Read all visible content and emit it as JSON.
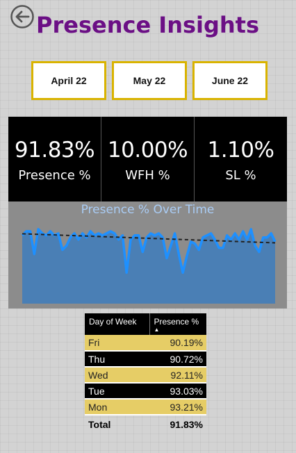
{
  "header": {
    "title": "Presence Insights",
    "back_icon": "back-arrow-icon"
  },
  "filters": [
    {
      "label": "April 22"
    },
    {
      "label": "May 22"
    },
    {
      "label": "June 22"
    }
  ],
  "kpis": [
    {
      "value": "91.83%",
      "label": "Presence %"
    },
    {
      "value": "10.00%",
      "label": "WFH %"
    },
    {
      "value": "1.10%",
      "label": "SL %"
    }
  ],
  "chart": {
    "title": "Presence % Over Time"
  },
  "chart_data": {
    "type": "area",
    "title": "Presence % Over Time",
    "xlabel": "",
    "ylabel": "",
    "series": [
      {
        "values": [
          93,
          95,
          95,
          84,
          96,
          94,
          93,
          95,
          93,
          94,
          86,
          88,
          92,
          94,
          91,
          94,
          92,
          95,
          93,
          94,
          93,
          94,
          95,
          94,
          91,
          93,
          75,
          91,
          93,
          93,
          85,
          92,
          94,
          93,
          94,
          92,
          82,
          88,
          94,
          84,
          75,
          83,
          90,
          89,
          86,
          92,
          93,
          94,
          91,
          87,
          87,
          93,
          91,
          94,
          91,
          95,
          91,
          96,
          88,
          85,
          92,
          92,
          94,
          90
        ]
      }
    ],
    "trendline": {
      "start": 93.8,
      "end": 89.4,
      "style": "dashed"
    },
    "ylim": [
      60,
      100
    ],
    "grid": false,
    "colors": {
      "area": "#4a7fb5",
      "line": "#1e90ff",
      "trend": "#222222",
      "background": "#8c8c8c",
      "title": "#a9ccf5"
    }
  },
  "table": {
    "columns": [
      "Day of Week",
      "Presence %"
    ],
    "sorted_column": 1,
    "sort_direction": "ascending",
    "rows": [
      {
        "day": "Fri",
        "value": "90.19%"
      },
      {
        "day": "Thu",
        "value": "90.72%"
      },
      {
        "day": "Wed",
        "value": "92.11%"
      },
      {
        "day": "Tue",
        "value": "93.03%"
      },
      {
        "day": "Mon",
        "value": "93.21%"
      }
    ],
    "total": {
      "label": "Total",
      "value": "91.83%"
    }
  },
  "colors": {
    "title": "#6b0f85",
    "filter_border": "#d9b300",
    "gold_row": "#e6cd66",
    "dark_row": "#000000"
  }
}
